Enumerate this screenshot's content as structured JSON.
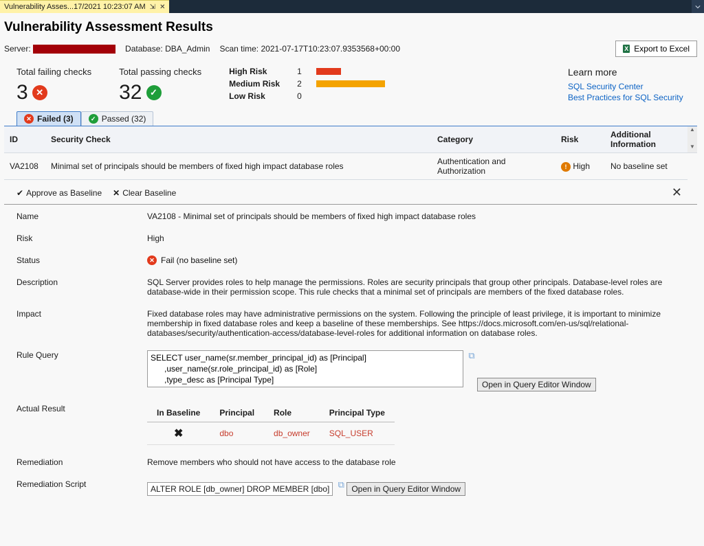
{
  "tab": {
    "title": "Vulnerability Asses...17/2021 10:23:07 AM"
  },
  "page_title": "Vulnerability Assessment Results",
  "meta": {
    "server_label": "Server:",
    "database_label": "Database:",
    "database": "DBA_Admin",
    "scan_label": "Scan time:",
    "scan_time": "2021-07-17T10:23:07.9353568+00:00",
    "export_label": "Export to Excel"
  },
  "summary": {
    "failing_label": "Total failing checks",
    "failing_count": "3",
    "passing_label": "Total passing checks",
    "passing_count": "32",
    "risk": {
      "high_label": "High Risk",
      "high_count": "1",
      "med_label": "Medium Risk",
      "med_count": "2",
      "low_label": "Low Risk",
      "low_count": "0"
    },
    "learn": {
      "heading": "Learn more",
      "link1": "SQL Security Center",
      "link2": "Best Practices for SQL Security"
    }
  },
  "result_tabs": {
    "failed": "Failed  (3)",
    "passed": "Passed  (32)"
  },
  "grid": {
    "headers": {
      "id": "ID",
      "check": "Security Check",
      "category": "Category",
      "risk": "Risk",
      "info": "Additional Information"
    },
    "row": {
      "id": "VA2108",
      "check": "Minimal set of principals should be members of fixed high impact database roles",
      "category": "Authentication and Authorization",
      "risk": "High",
      "info": "No baseline set"
    }
  },
  "detail_toolbar": {
    "approve": "Approve as Baseline",
    "clear": "Clear Baseline"
  },
  "detail": {
    "name_label": "Name",
    "name_value": "VA2108 - Minimal set of principals should be members of fixed high impact database roles",
    "risk_label": "Risk",
    "risk_value": "High",
    "status_label": "Status",
    "status_value": "Fail (no baseline set)",
    "desc_label": "Description",
    "desc_value": "SQL Server provides roles to help manage the permissions. Roles are security principals that group other principals. Database-level roles are database-wide in their permission scope. This rule checks that a minimal set of principals are members of the fixed database roles.",
    "impact_label": "Impact",
    "impact_value": "Fixed database roles may have administrative permissions on the system. Following the principle of least privilege, it is important to minimize membership in fixed database roles and keep a baseline of these memberships. See https://docs.microsoft.com/en-us/sql/relational-databases/security/authentication-access/database-level-roles for additional information on database roles.",
    "query_label": "Rule Query",
    "query_value": "SELECT user_name(sr.member_principal_id) as [Principal]\n      ,user_name(sr.role_principal_id) as [Role]\n      ,type_desc as [Principal Type]",
    "open_query": "Open in Query Editor Window",
    "actual_label": "Actual Result",
    "actual_headers": {
      "baseline": "In Baseline",
      "principal": "Principal",
      "role": "Role",
      "ptype": "Principal Type"
    },
    "actual_row": {
      "baseline_icon": "✖",
      "principal": "dbo",
      "role": "db_owner",
      "ptype": "SQL_USER"
    },
    "rem_label": "Remediation",
    "rem_value": "Remove members who should not have access to the database role",
    "rscript_label": "Remediation Script",
    "rscript_value": "ALTER ROLE [db_owner] DROP MEMBER [dbo]"
  }
}
